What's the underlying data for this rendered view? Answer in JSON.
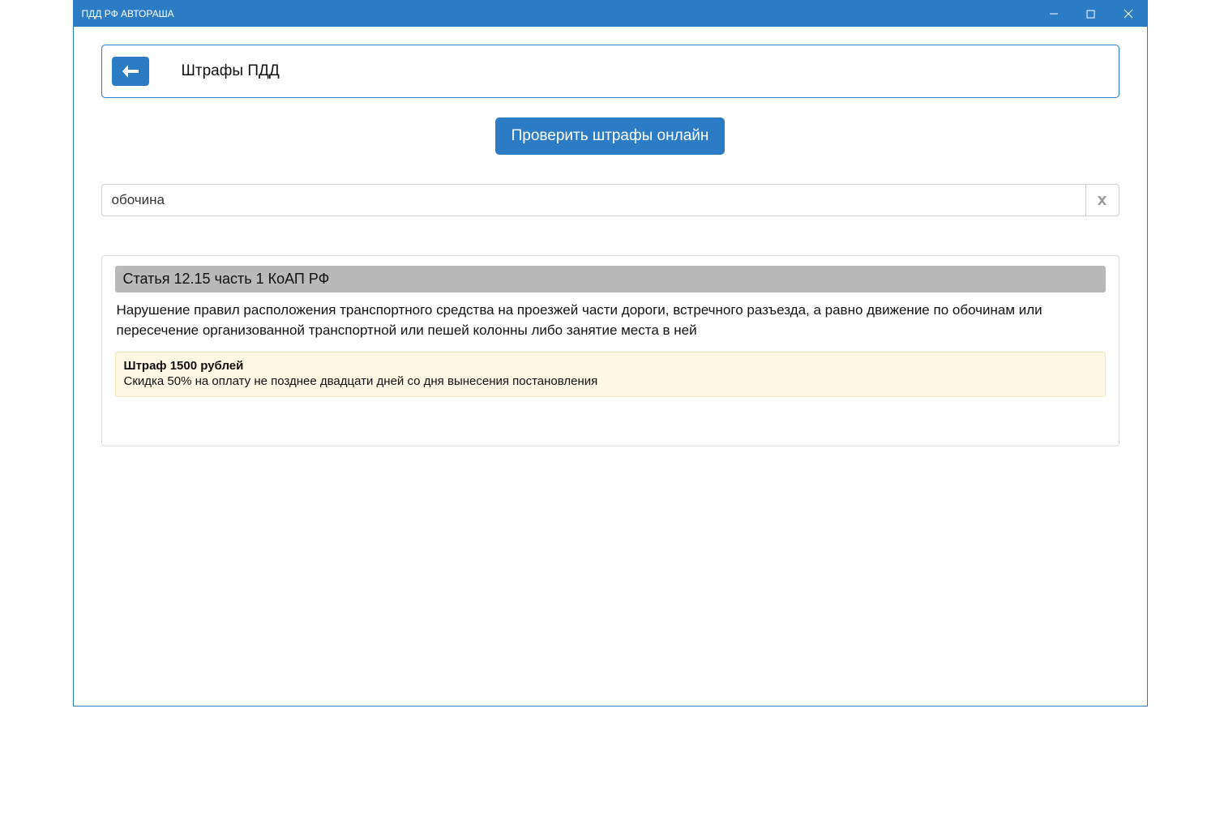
{
  "window": {
    "title": "ПДД РФ АВТОРАША"
  },
  "header": {
    "title": "Штрафы ПДД"
  },
  "actions": {
    "check_online_label": "Проверить штрафы онлайн"
  },
  "search": {
    "value": "обочина"
  },
  "results": [
    {
      "article_title": "Статья 12.15 часть 1 КоАП РФ",
      "article_text": "Нарушение правил расположения транспортного средства на проезжей части дороги, встречного разъезда, а равно движение по обочинам или пересечение организованной транспортной или пешей колонны либо занятие места в ней",
      "penalty_title": "Штраф 1500 рублей",
      "penalty_note": "Скидка 50% на оплату не позднее двадцати дней со дня вынесения постановления"
    }
  ]
}
